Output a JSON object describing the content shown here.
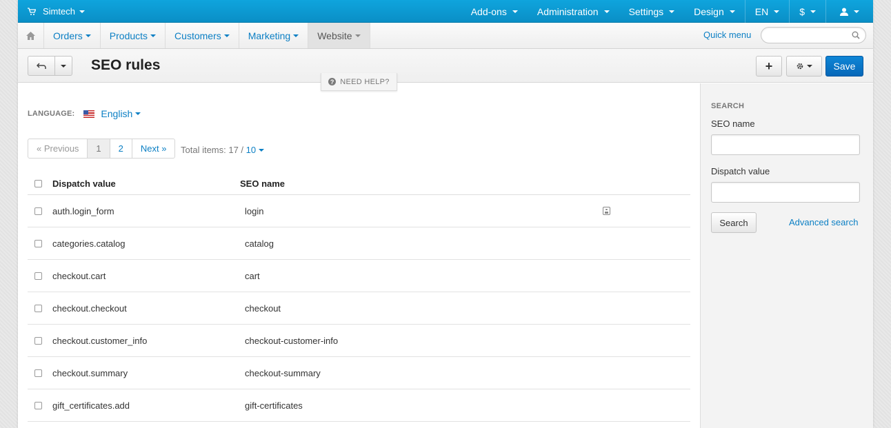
{
  "topbar": {
    "brand": "Simtech",
    "menu": [
      "Add-ons",
      "Administration",
      "Settings",
      "Design"
    ],
    "lang": "EN",
    "currency": "$"
  },
  "nav": {
    "items": [
      "Orders",
      "Products",
      "Customers",
      "Marketing",
      "Website"
    ],
    "active": "Website",
    "quick_menu": "Quick menu",
    "search_placeholder": ""
  },
  "header": {
    "title": "SEO rules",
    "save_label": "Save",
    "plus_label": "+",
    "need_help": "NEED HELP?"
  },
  "language": {
    "label": "LANGUAGE:",
    "value": "English"
  },
  "pagination": {
    "prev": "« Previous",
    "pages": [
      "1",
      "2"
    ],
    "current": "1",
    "next": "Next »",
    "total_label": "Total items: 17 /",
    "per_page": "10"
  },
  "table": {
    "headers": {
      "dispatch": "Dispatch value",
      "seo": "SEO name"
    },
    "rows": [
      {
        "dispatch": "auth.login_form",
        "seo": "login"
      },
      {
        "dispatch": "categories.catalog",
        "seo": "catalog"
      },
      {
        "dispatch": "checkout.cart",
        "seo": "cart"
      },
      {
        "dispatch": "checkout.checkout",
        "seo": "checkout"
      },
      {
        "dispatch": "checkout.customer_info",
        "seo": "checkout-customer-info"
      },
      {
        "dispatch": "checkout.summary",
        "seo": "checkout-summary"
      },
      {
        "dispatch": "gift_certificates.add",
        "seo": "gift-certificates"
      }
    ]
  },
  "sidebar": {
    "title": "SEARCH",
    "seo_name_label": "SEO name",
    "seo_name_value": "",
    "dispatch_label": "Dispatch value",
    "dispatch_value": "",
    "search_button": "Search",
    "advanced_link": "Advanced search"
  },
  "colors": {
    "topbar": "#0fa4dd",
    "link": "#0b7fc4",
    "save": "#0667b8"
  }
}
